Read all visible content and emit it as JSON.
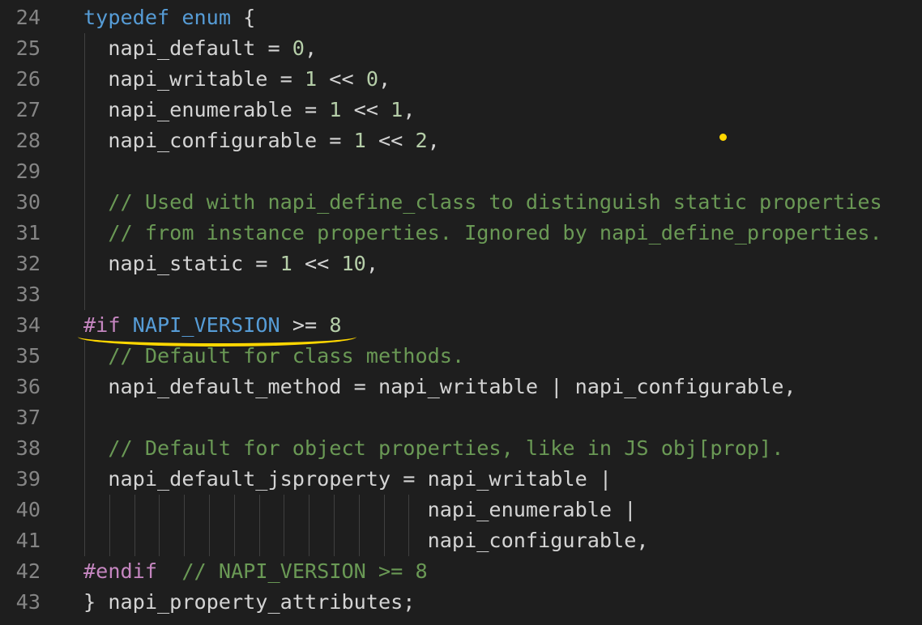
{
  "editor": {
    "language": "c",
    "highlight_color": "#ffd700",
    "lines": [
      {
        "num": "24",
        "segments": [
          {
            "t": "typedef",
            "c": "kw"
          },
          {
            "t": " "
          },
          {
            "t": "enum",
            "c": "kw"
          },
          {
            "t": " {"
          }
        ]
      },
      {
        "num": "25",
        "segments": [
          {
            "t": "  napi_default = "
          },
          {
            "t": "0",
            "c": "num"
          },
          {
            "t": ","
          }
        ]
      },
      {
        "num": "26",
        "segments": [
          {
            "t": "  napi_writable = "
          },
          {
            "t": "1",
            "c": "num"
          },
          {
            "t": " << "
          },
          {
            "t": "0",
            "c": "num"
          },
          {
            "t": ","
          }
        ]
      },
      {
        "num": "27",
        "segments": [
          {
            "t": "  napi_enumerable = "
          },
          {
            "t": "1",
            "c": "num"
          },
          {
            "t": " << "
          },
          {
            "t": "1",
            "c": "num"
          },
          {
            "t": ","
          }
        ]
      },
      {
        "num": "28",
        "segments": [
          {
            "t": "  napi_configurable = "
          },
          {
            "t": "1",
            "c": "num"
          },
          {
            "t": " << "
          },
          {
            "t": "2",
            "c": "num"
          },
          {
            "t": ","
          }
        ]
      },
      {
        "num": "29",
        "segments": []
      },
      {
        "num": "30",
        "segments": [
          {
            "t": "  "
          },
          {
            "t": "// Used with napi_define_class to distinguish static properties",
            "c": "cmt"
          }
        ]
      },
      {
        "num": "31",
        "segments": [
          {
            "t": "  "
          },
          {
            "t": "// from instance properties. Ignored by napi_define_properties.",
            "c": "cmt"
          }
        ]
      },
      {
        "num": "32",
        "segments": [
          {
            "t": "  napi_static = "
          },
          {
            "t": "1",
            "c": "num"
          },
          {
            "t": " << "
          },
          {
            "t": "10",
            "c": "num"
          },
          {
            "t": ","
          }
        ]
      },
      {
        "num": "33",
        "segments": []
      },
      {
        "num": "34",
        "segments": [
          {
            "t": "#if",
            "c": "pp"
          },
          {
            "t": " "
          },
          {
            "t": "NAPI_VERSION",
            "c": "mac"
          },
          {
            "t": " >= "
          },
          {
            "t": "8",
            "c": "num"
          }
        ]
      },
      {
        "num": "35",
        "segments": [
          {
            "t": "  "
          },
          {
            "t": "// Default for class methods.",
            "c": "cmt"
          }
        ]
      },
      {
        "num": "36",
        "segments": [
          {
            "t": "  napi_default_method = napi_writable | napi_configurable,"
          }
        ]
      },
      {
        "num": "37",
        "segments": []
      },
      {
        "num": "38",
        "segments": [
          {
            "t": "  "
          },
          {
            "t": "// Default for object properties, like in JS obj[prop].",
            "c": "cmt"
          }
        ]
      },
      {
        "num": "39",
        "segments": [
          {
            "t": "  napi_default_jsproperty = napi_writable |"
          }
        ]
      },
      {
        "num": "40",
        "segments": [
          {
            "t": "                            napi_enumerable |"
          }
        ]
      },
      {
        "num": "41",
        "segments": [
          {
            "t": "                            napi_configurable,"
          }
        ]
      },
      {
        "num": "42",
        "segments": [
          {
            "t": "#endif",
            "c": "pp"
          },
          {
            "t": "  "
          },
          {
            "t": "// NAPI_VERSION >= 8",
            "c": "cmt"
          }
        ]
      },
      {
        "num": "43",
        "segments": [
          {
            "t": "} napi_property_attributes;"
          }
        ]
      }
    ]
  }
}
